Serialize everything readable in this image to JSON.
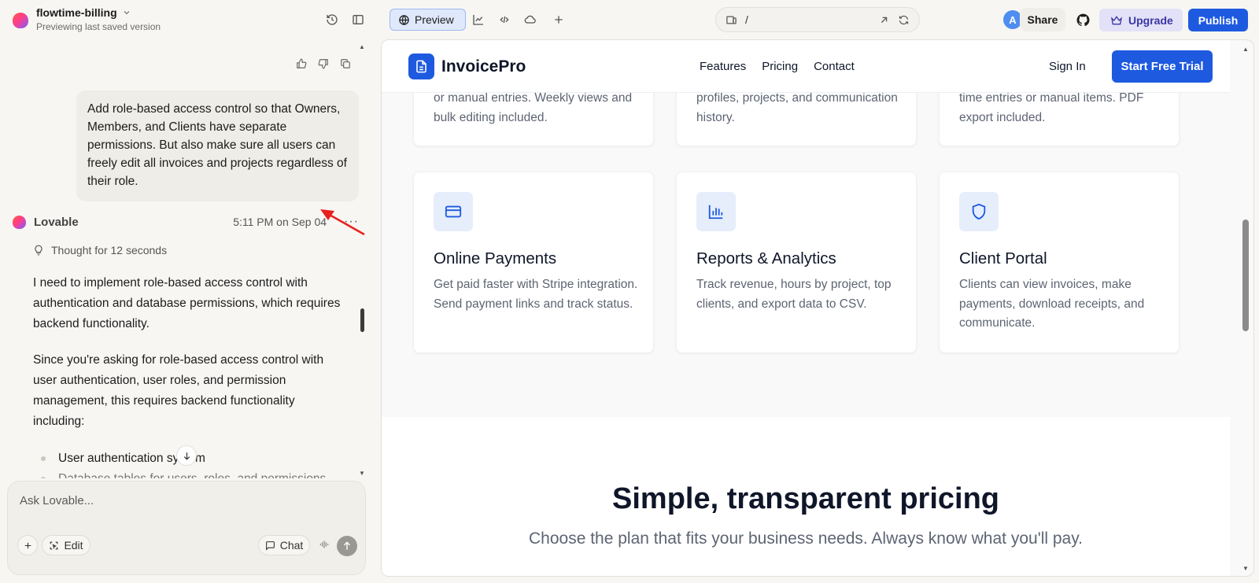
{
  "topbar": {
    "project_name": "flowtime-billing",
    "project_subtitle": "Previewing last saved version",
    "preview_label": "Preview",
    "url_path": "/",
    "avatar_initial": "A",
    "share_label": "Share",
    "upgrade_label": "Upgrade",
    "publish_label": "Publish"
  },
  "chat": {
    "user_message": "Add role-based access control so that Owners, Members, and Clients have separate permissions. But also make sure all users can freely edit all invoices and projects regardless of their role.",
    "assistant_name": "Lovable",
    "assistant_time": "5:11 PM on Sep 04",
    "more_label": "···",
    "thought_label": "Thought for 12 seconds",
    "paragraph_1": "I need to implement role-based access control with authentication and database permissions, which requires backend functionality.",
    "paragraph_2": "Since you're asking for role-based access control with user authentication, user roles, and permission management, this requires backend functionality including:",
    "list_items": [
      "User authentication system",
      "Database tables for users, roles, and permissions"
    ],
    "composer_placeholder": "Ask Lovable...",
    "edit_label": "Edit",
    "chat_label": "Chat"
  },
  "preview": {
    "brand": "InvoicePro",
    "nav_links": [
      "Features",
      "Pricing",
      "Contact"
    ],
    "sign_in": "Sign In",
    "cta": "Start Free Trial",
    "top_cards": [
      {
        "desc": "or manual entries. Weekly views and bulk editing included."
      },
      {
        "desc": "profiles, projects, and communication history."
      },
      {
        "desc": "time entries or manual items. PDF export included."
      }
    ],
    "feature_cards": [
      {
        "icon": "credit-card-icon",
        "title": "Online Payments",
        "desc": "Get paid faster with Stripe integration. Send payment links and track status."
      },
      {
        "icon": "bar-chart-icon",
        "title": "Reports & Analytics",
        "desc": "Track revenue, hours by project, top clients, and export data to CSV."
      },
      {
        "icon": "shield-icon",
        "title": "Client Portal",
        "desc": "Clients can view invoices, make payments, download receipts, and communicate."
      }
    ],
    "pricing_title": "Simple, transparent pricing",
    "pricing_subtitle": "Choose the plan that fits your business needs. Always know what you'll pay."
  },
  "colors": {
    "accent": "#1e5ae0",
    "preview_tab_bg": "#dfe9fb",
    "upgrade_bg": "#e3e1f7",
    "annotation_arrow": "#e8201e"
  }
}
